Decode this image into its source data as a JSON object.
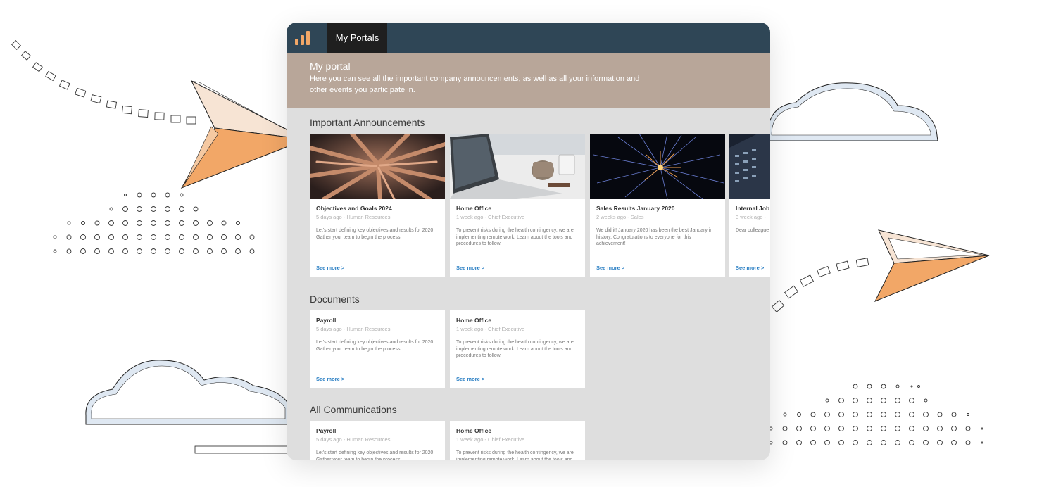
{
  "colors": {
    "topbar": "#2f4656",
    "hero": "#b8a699",
    "accent": "#f2a767",
    "link": "#2a7fc4",
    "panel": "#dedede"
  },
  "app": {
    "logo_icon": "bar-chart-icon",
    "tab": "My Portals"
  },
  "hero": {
    "title": "My portal",
    "description": "Here you can see all the important company announcements, as well as all your information and other events you participate in."
  },
  "announcements": {
    "title": "Important Announcements",
    "cards": [
      {
        "title": "Objectives and Goals 2024",
        "meta": "5 days ago - Human Resources",
        "text": "Let's start defining key objectives and results for 2020. Gather your team to begin the process.",
        "link": "See more >",
        "image": "team-hands-photo"
      },
      {
        "title": "Home Office",
        "meta": "1 week ago - Chief Executive",
        "text": "To prevent risks during the health contingency, we are implementing remote work. Learn about the tools and procedures to follow.",
        "link": "See more >",
        "image": "laptop-coffee-photo"
      },
      {
        "title": "Sales Results January 2020",
        "meta": "2 weeks ago - Sales",
        "text": "We did it! January 2020 has been the best January in history. Congratulations to everyone for this achievement!",
        "link": "See more >",
        "image": "fireworks-photo"
      },
      {
        "title": "Internal Job",
        "meta": "3 week ago -",
        "text": "Dear colleague openings withi",
        "link": "See more >",
        "image": "building-photo"
      }
    ]
  },
  "documents": {
    "title": "Documents",
    "cards": [
      {
        "title": "Payroll",
        "meta": "5 days ago - Human Resources",
        "text": "Let's start defining key objectives and results for 2020. Gather your team to begin the process.",
        "link": "See more >"
      },
      {
        "title": "Home Office",
        "meta": "1 week ago - Chief Executive",
        "text": "To prevent risks during the health contingency, we are implementing remote work. Learn about the tools and procedures to follow.",
        "link": "See more >"
      }
    ]
  },
  "communications": {
    "title": "All Communications",
    "cards": [
      {
        "title": "Payroll",
        "meta": "5 days ago - Human Resources",
        "text": "Let's start defining key objectives and results for 2020. Gather your team to begin the process."
      },
      {
        "title": "Home Office",
        "meta": "1 week ago - Chief Executive",
        "text": "To prevent risks during the health contingency, we are implementing remote work. Learn about the tools and"
      }
    ]
  }
}
